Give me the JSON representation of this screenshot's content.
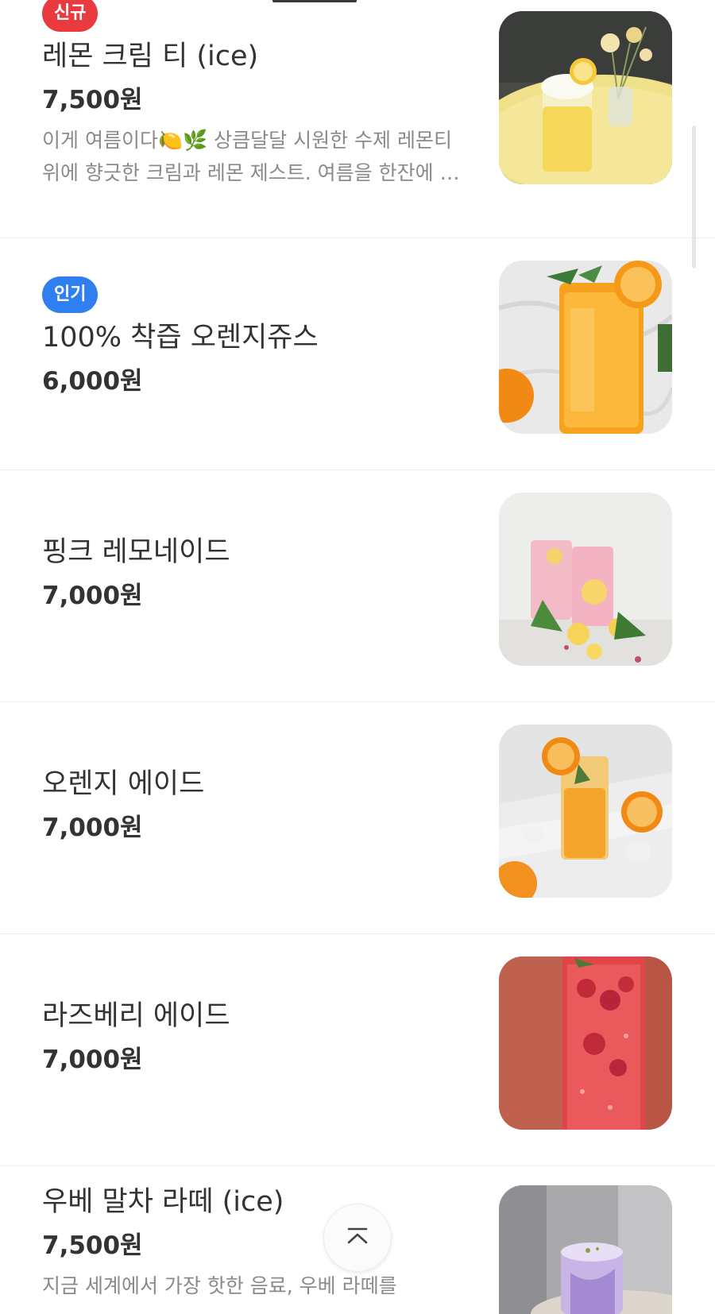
{
  "menu": {
    "items": [
      {
        "badge": "신규",
        "name": "레몬 크림 티 (ice)",
        "price": "7,500원",
        "description": "이게 여름이다🍋🌿 상큼달달 시원한 수제 레몬티 위에 향긋한 크림과 레몬 제스트. 여름을 한잔에 담았어요",
        "image": "lemon-cream-tea-photo"
      },
      {
        "badge": "인기",
        "name": "100% 착즙 오렌지쥬스",
        "price": "6,000원",
        "image": "orange-juice-photo"
      },
      {
        "name": "핑크 레모네이드",
        "price": "7,000원",
        "image": "pink-lemonade-photo"
      },
      {
        "name": "오렌지 에이드",
        "price": "7,000원",
        "image": "orange-ade-photo"
      },
      {
        "name": "라즈베리 에이드",
        "price": "7,000원",
        "image": "raspberry-ade-photo"
      },
      {
        "name": "우베 말차 라떼 (ice)",
        "price": "7,500원",
        "description": "지금 세계에서 가장 핫한 음료, 우베 라떼를",
        "image": "ube-matcha-latte-photo"
      }
    ]
  },
  "colors": {
    "badge_new": "#e83a3f",
    "badge_popular": "#2f7ff0"
  },
  "scroll_top_icon": "chevron-up-icon"
}
